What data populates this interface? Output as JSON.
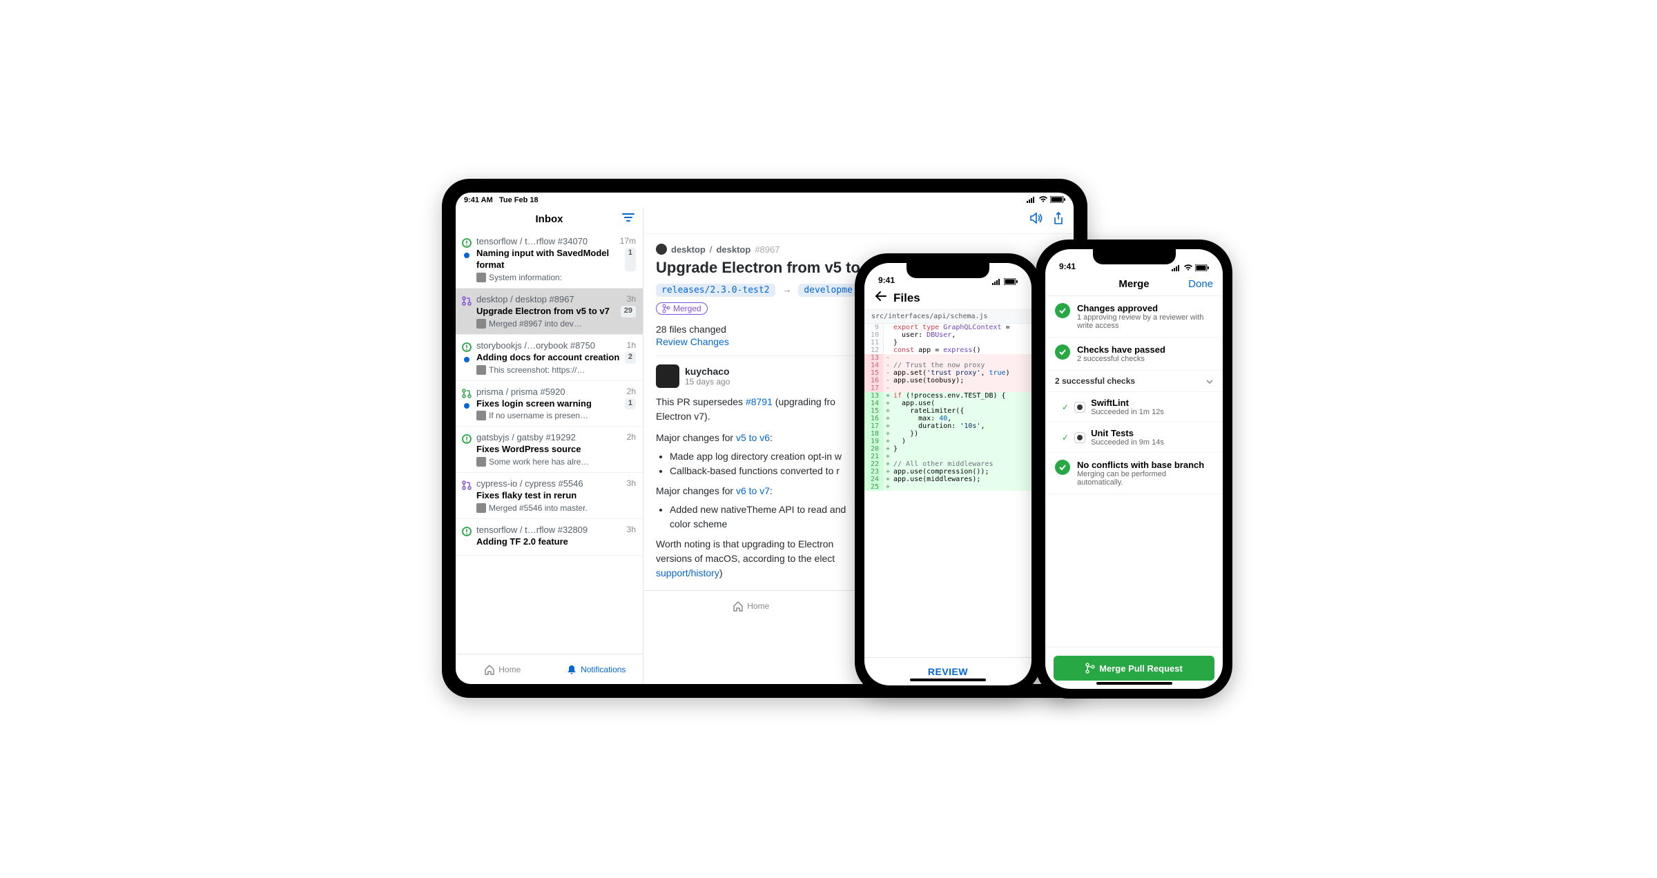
{
  "ipad": {
    "status": {
      "time": "9:41 AM",
      "date": "Tue Feb 18"
    },
    "sidebar": {
      "title": "Inbox",
      "items": [
        {
          "icon": "issue-open",
          "icon_color": "#28a745",
          "dot": true,
          "repo": "tensorflow / t…rflow #34070",
          "time": "17m",
          "title": "Naming input with SavedModel format",
          "badge": "1",
          "sub": "System information:"
        },
        {
          "icon": "pr-merged",
          "icon_color": "#8250df",
          "dot": false,
          "selected": true,
          "repo": "desktop / desktop #8967",
          "time": "3h",
          "title": "Upgrade Electron from v5 to v7",
          "badge": "29",
          "sub": "Merged #8967 into dev…"
        },
        {
          "icon": "issue-open",
          "icon_color": "#28a745",
          "dot": true,
          "repo": "storybookjs /…orybook #8750",
          "time": "1h",
          "title": "Adding docs for account creation",
          "badge": "2",
          "sub": "This screenshot: https://…"
        },
        {
          "icon": "pr-open",
          "icon_color": "#28a745",
          "dot": true,
          "repo": "prisma / prisma #5920",
          "time": "2h",
          "title": "Fixes login screen warning",
          "badge": "1",
          "sub": "If no username is presen…"
        },
        {
          "icon": "issue-open",
          "icon_color": "#28a745",
          "dot": false,
          "repo": "gatsbyjs / gatsby #19292",
          "time": "2h",
          "title": "Fixes WordPress source",
          "badge": "",
          "sub": "Some work here has alre…"
        },
        {
          "icon": "pr-merged",
          "icon_color": "#8250df",
          "dot": false,
          "repo": "cypress-io / cypress #5546",
          "time": "3h",
          "title": "Fixes flaky test in rerun",
          "badge": "",
          "sub": "Merged #5546 into master."
        },
        {
          "icon": "issue-open",
          "icon_color": "#28a745",
          "dot": false,
          "repo": "tensorflow / t…rflow #32809",
          "time": "3h",
          "title": "Adding TF 2.0 feature",
          "badge": "",
          "sub": ""
        }
      ]
    },
    "tabs": {
      "home": "Home",
      "notifications": "Notifications"
    },
    "detail": {
      "breadcrumb_owner": "desktop",
      "breadcrumb_sep": "/",
      "breadcrumb_repo": "desktop",
      "breadcrumb_num": "#8967",
      "title": "Upgrade Electron from v5 to v7",
      "branch_src": "releases/2.3.0-test2",
      "branch_dst": "developme",
      "merged_label": "Merged",
      "files_changed": "28 files changed",
      "review_changes": "Review Changes",
      "author": "kuychaco",
      "author_time": "15 days ago",
      "body_p1_pre": "This PR supersedes ",
      "body_p1_link": "#8791",
      "body_p1_post": " (upgrading fro",
      "body_p1_line2": "Electron v7).",
      "body_p2_pre": "Major changes for ",
      "body_p2_link": "v5 to v6",
      "body_p2_post": ":",
      "bullet1": "Made app log directory creation opt-in w",
      "bullet2": "Callback-based functions converted to r",
      "body_p3_pre": "Major changes for ",
      "body_p3_link": "v6 to v7",
      "body_p3_post": ":",
      "bullet3a": "Added new nativeTheme API to read and",
      "bullet3b": "color scheme",
      "body_p4_a": "Worth noting is that upgrading to Electron",
      "body_p4_b": "versions of macOS, according to the elect",
      "body_p4_link": "support/history",
      "body_p4_paren": ")"
    }
  },
  "phone_files": {
    "status_time": "9:41",
    "header_title": "Files",
    "path": "src/interfaces/api/schema.js",
    "review": "REVIEW",
    "code": [
      {
        "n": "9",
        "kind": "ctx",
        "html": "<span class='kw'>export</span> <span class='kw'>type</span> <span class='type'>GraphQLContext</span> ="
      },
      {
        "n": "10",
        "kind": "ctx",
        "html": "  user: <span class='type'>DBUser</span>,"
      },
      {
        "n": "11",
        "kind": "ctx",
        "html": "}"
      },
      {
        "n": "12",
        "kind": "ctx",
        "html": "<span class='kw'>const</span> app = <span class='type'>express</span>()"
      },
      {
        "n": "13",
        "kind": "del",
        "html": ""
      },
      {
        "n": "14",
        "kind": "del",
        "html": "<span class='comment'>// Trust the now proxy</span>"
      },
      {
        "n": "15",
        "kind": "del",
        "html": "app.set(<span class='str'>'trust proxy'</span>, <span class='num-lit'>true</span>)"
      },
      {
        "n": "16",
        "kind": "del",
        "html": "app.use(toobusy);"
      },
      {
        "n": "17",
        "kind": "del",
        "html": ""
      },
      {
        "n": "13",
        "kind": "add",
        "html": "<span class='kw'>if</span> (!process.env.TEST_DB) {"
      },
      {
        "n": "14",
        "kind": "add",
        "html": "  app.use("
      },
      {
        "n": "15",
        "kind": "add",
        "html": "    rateLimiter({"
      },
      {
        "n": "16",
        "kind": "add",
        "html": "      max: <span class='num-lit'>40</span>,"
      },
      {
        "n": "17",
        "kind": "add",
        "html": "      duration: <span class='str'>'10s'</span>,"
      },
      {
        "n": "18",
        "kind": "add",
        "html": "    })"
      },
      {
        "n": "19",
        "kind": "add",
        "html": "  )"
      },
      {
        "n": "20",
        "kind": "add",
        "html": "}"
      },
      {
        "n": "21",
        "kind": "add",
        "html": ""
      },
      {
        "n": "22",
        "kind": "add",
        "html": "<span class='comment'>// All other middlewares</span>"
      },
      {
        "n": "23",
        "kind": "add",
        "html": "app.use(compression());"
      },
      {
        "n": "24",
        "kind": "add",
        "html": "app.use(middlewares);"
      },
      {
        "n": "25",
        "kind": "add",
        "html": ""
      }
    ]
  },
  "phone_merge": {
    "status_time": "9:41",
    "header_title": "Merge",
    "done": "Done",
    "rows": [
      {
        "title": "Changes approved",
        "sub": "1 approving review by a reviewer with write access"
      },
      {
        "title": "Checks have passed",
        "sub": "2 successful checks"
      }
    ],
    "checks_header": "2 successful checks",
    "checks": [
      {
        "name": "SwiftLint",
        "sub": "Succeeded in 1m 12s"
      },
      {
        "name": "Unit Tests",
        "sub": "Succeeded in 9m 14s"
      }
    ],
    "conflict_row": {
      "title": "No conflicts with base branch",
      "sub": "Merging can be performed automatically."
    },
    "button": "Merge Pull Request"
  }
}
